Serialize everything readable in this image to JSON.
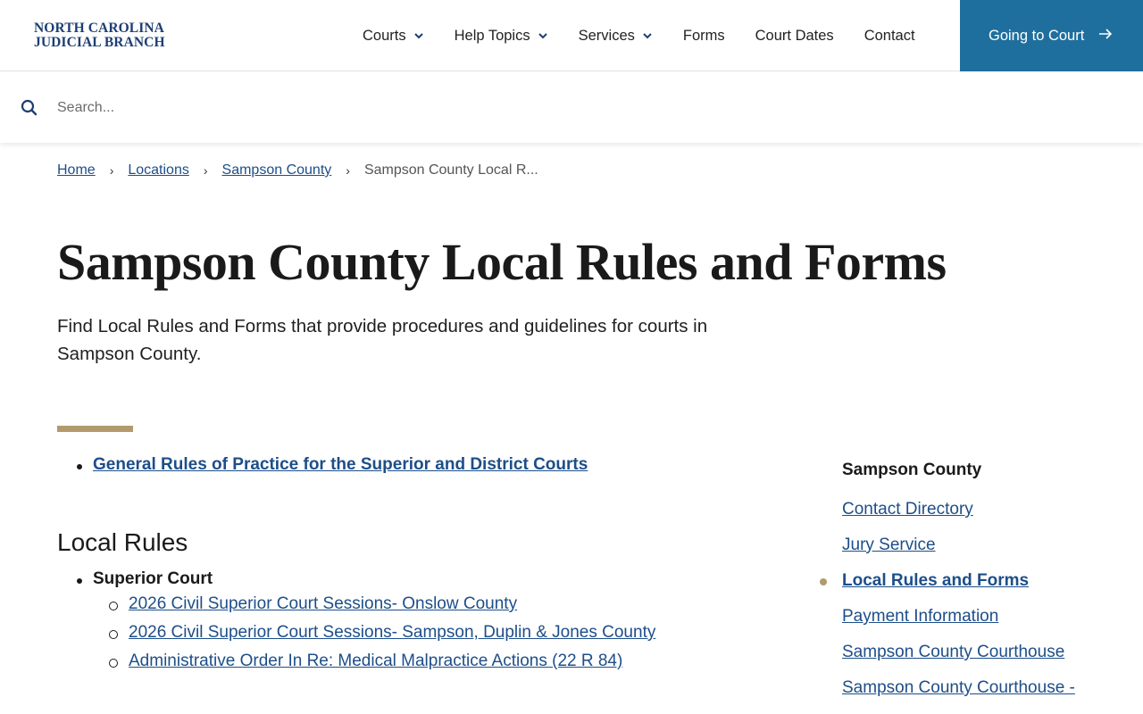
{
  "header": {
    "logo_line1": "NORTH CAROLINA",
    "logo_line2": "JUDICIAL BRANCH",
    "nav": [
      {
        "label": "Courts",
        "has_dropdown": true
      },
      {
        "label": "Help Topics",
        "has_dropdown": true
      },
      {
        "label": "Services",
        "has_dropdown": true
      },
      {
        "label": "Forms",
        "has_dropdown": false
      },
      {
        "label": "Court Dates",
        "has_dropdown": false
      },
      {
        "label": "Contact",
        "has_dropdown": false
      }
    ],
    "cta_label": "Going to Court"
  },
  "search": {
    "placeholder": "Search..."
  },
  "breadcrumb": {
    "items": [
      "Home",
      "Locations",
      "Sampson County"
    ],
    "current": "Sampson County Local R..."
  },
  "page": {
    "title": "Sampson County Local Rules and Forms",
    "intro": "Find Local Rules and Forms that provide procedures and guidelines for courts in Sampson County."
  },
  "main": {
    "top_link": "General Rules of Practice for the Superior and District Courts",
    "section_title": "Local Rules",
    "group_label": "Superior Court",
    "links": [
      "2026 Civil Superior Court Sessions- Onslow County",
      "2026 Civil Superior Court Sessions- Sampson, Duplin & Jones County",
      "Administrative Order In Re: Medical Malpractice Actions (22 R 84)"
    ]
  },
  "sidebar": {
    "title": "Sampson County",
    "items": [
      {
        "label": "Contact Directory",
        "active": false
      },
      {
        "label": "Jury Service",
        "active": false
      },
      {
        "label": "Local Rules and Forms",
        "active": true
      },
      {
        "label": "Payment Information",
        "active": false
      },
      {
        "label": "Sampson County Courthouse",
        "active": false
      },
      {
        "label": "Sampson County Courthouse -",
        "active": false
      }
    ]
  },
  "colors": {
    "brand_blue": "#1d3e73",
    "cta_blue": "#1f6f9e",
    "link": "#1d4e89",
    "accent_gold": "#b29a6c"
  }
}
